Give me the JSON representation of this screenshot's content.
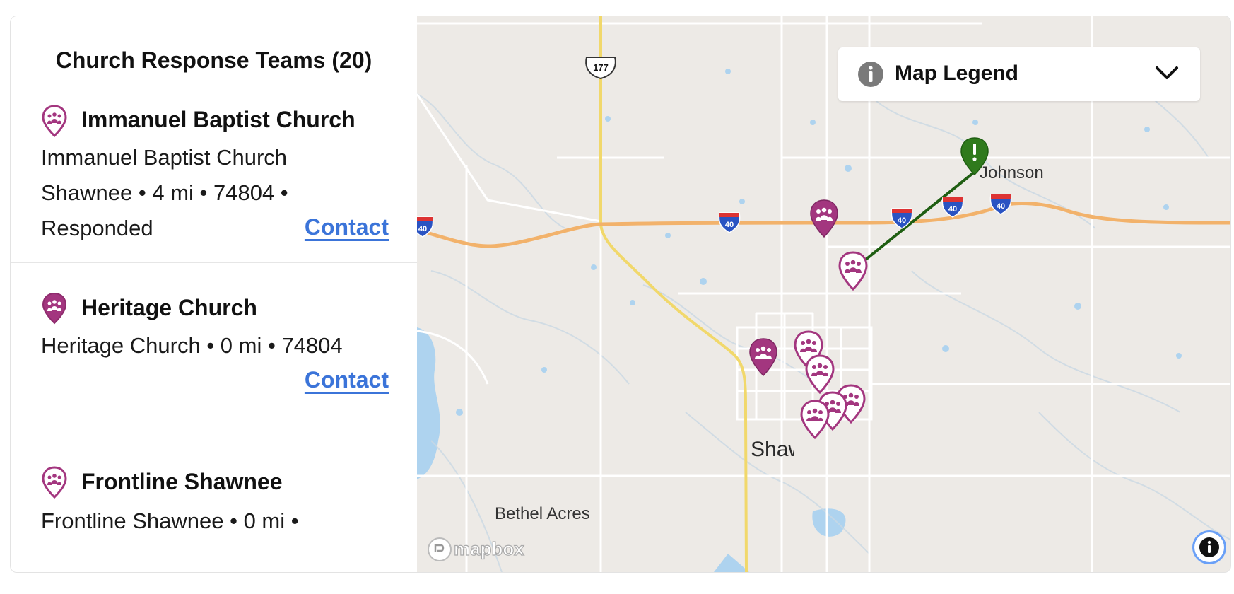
{
  "sidebar": {
    "title": "Church Response Teams (20)",
    "items": [
      {
        "name": "Immanuel Baptist Church",
        "lines": [
          "Immanuel Baptist Church",
          "Shawnee • 4 mi • 74804 •",
          "Responded"
        ],
        "contact": "Contact",
        "pin_style": "outline"
      },
      {
        "name": "Heritage Church",
        "lines": [
          "Heritage Church • 0 mi • 74804"
        ],
        "contact": "Contact",
        "pin_style": "filled"
      },
      {
        "name": "Frontline Shawnee",
        "lines": [
          "Frontline Shawnee • 0 mi •"
        ],
        "contact": "",
        "pin_style": "outline"
      }
    ]
  },
  "map": {
    "legend_label": "Map Legend",
    "legend_icon": "info-icon",
    "legend_toggle_icon": "chevron-down-icon",
    "places": {
      "johnson": "Johnson",
      "shawnee": "Shawnee",
      "bethel_acres": "Bethel Acres"
    },
    "road_shields": {
      "us_route": "177",
      "interstate": "40"
    },
    "logo_text": "mapbox",
    "attribution_icon": "info-icon"
  },
  "colors": {
    "accent": "#a3367f",
    "link": "#3b74d9",
    "alert_marker": "#2f7a1c",
    "alert_line": "#1f5e12",
    "interstate": "#f2b26b",
    "us_highway": "#f1d86b",
    "water": "#aed3ef",
    "land": "#edeae6"
  }
}
